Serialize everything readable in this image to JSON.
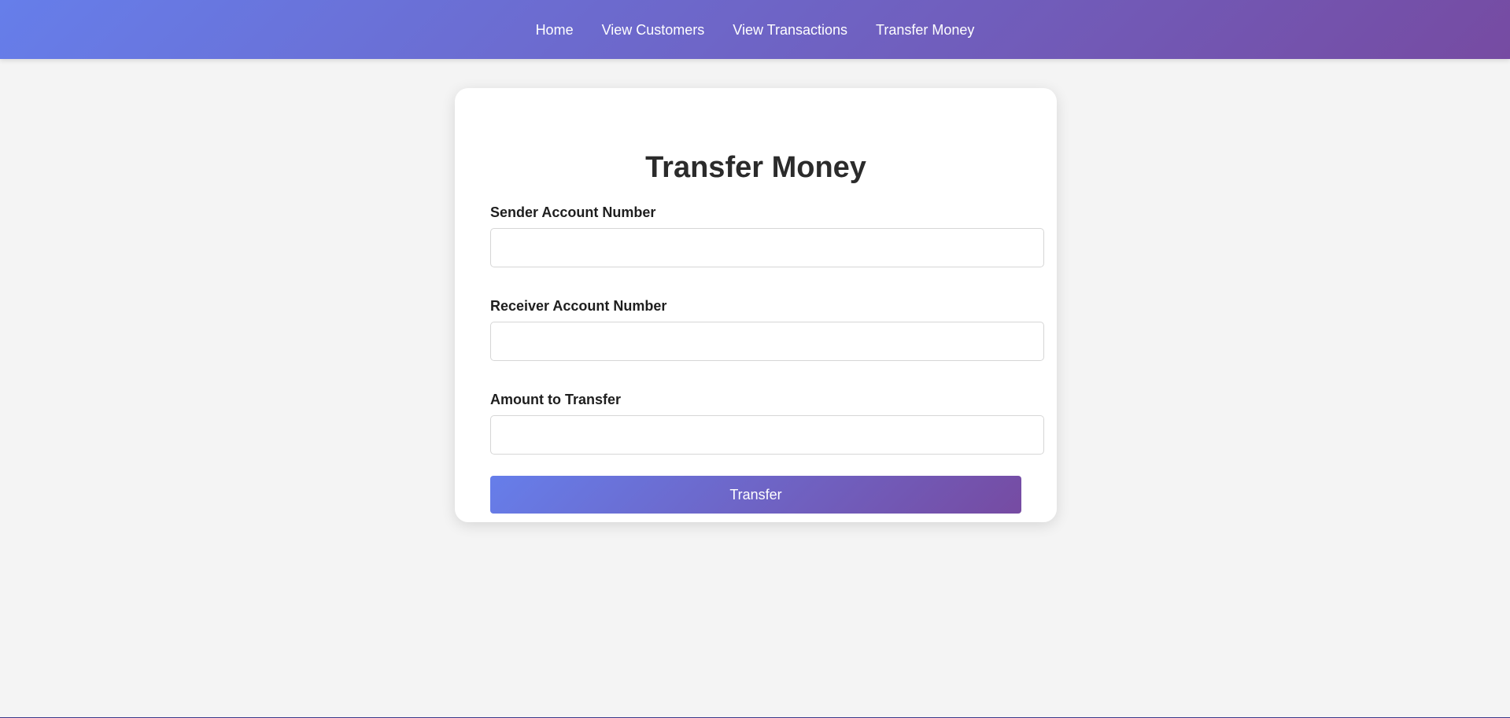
{
  "nav": {
    "items": [
      {
        "label": "Home"
      },
      {
        "label": "View Customers"
      },
      {
        "label": "View Transactions"
      },
      {
        "label": "Transfer Money"
      }
    ]
  },
  "form": {
    "title": "Transfer Money",
    "sender": {
      "label": "Sender Account Number",
      "value": "",
      "placeholder": ""
    },
    "receiver": {
      "label": "Receiver Account Number",
      "value": "",
      "placeholder": ""
    },
    "amount": {
      "label": "Amount to Transfer",
      "value": "",
      "placeholder": ""
    },
    "submit_label": "Transfer"
  },
  "colors": {
    "gradient_start": "#667eea",
    "gradient_end": "#764ba2",
    "page_background": "#f4f4f4",
    "card_background": "#ffffff"
  }
}
